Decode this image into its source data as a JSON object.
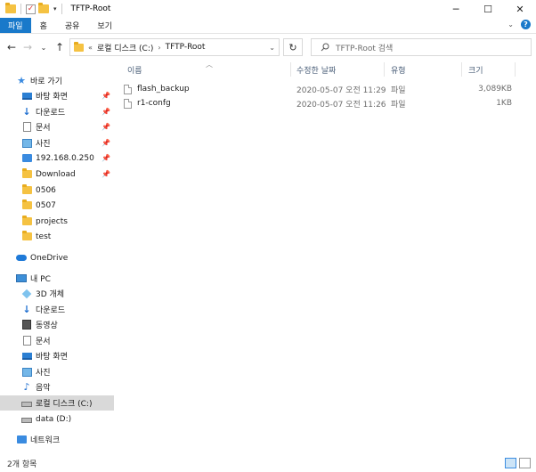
{
  "window": {
    "title": "TFTP-Root",
    "controls": [
      "─",
      "☐",
      "✕"
    ]
  },
  "ribbon": {
    "tabs": [
      "파일",
      "홈",
      "공유",
      "보기"
    ]
  },
  "address": {
    "overflow": "«",
    "crumbs": [
      "로컬 디스크 (C:)",
      "TFTP-Root"
    ],
    "search_placeholder": "TFTP-Root 검색"
  },
  "sidebar": {
    "quick_access": "바로 가기",
    "items": [
      {
        "label": "바탕 화면",
        "icon": "desktop-icon",
        "pinned": true
      },
      {
        "label": "다운로드",
        "icon": "download-icon",
        "pinned": true
      },
      {
        "label": "문서",
        "icon": "document-icon",
        "pinned": true
      },
      {
        "label": "사진",
        "icon": "picture-icon",
        "pinned": true
      },
      {
        "label": "192.168.0.250",
        "icon": "network-drive-icon",
        "pinned": true
      },
      {
        "label": "Download",
        "icon": "folder-icon",
        "pinned": true
      },
      {
        "label": "0506",
        "icon": "folder-icon",
        "pinned": false
      },
      {
        "label": "0507",
        "icon": "folder-icon",
        "pinned": false
      },
      {
        "label": "projects",
        "icon": "folder-icon",
        "pinned": false
      },
      {
        "label": "test",
        "icon": "folder-icon",
        "pinned": false
      }
    ],
    "onedrive": "OneDrive",
    "this_pc": "내 PC",
    "pc_items": [
      {
        "label": "3D 개체",
        "icon": "cube-icon"
      },
      {
        "label": "다운로드",
        "icon": "download-icon"
      },
      {
        "label": "동영상",
        "icon": "video-icon"
      },
      {
        "label": "문서",
        "icon": "document-icon"
      },
      {
        "label": "바탕 화면",
        "icon": "desktop-icon"
      },
      {
        "label": "사진",
        "icon": "picture-icon"
      },
      {
        "label": "음악",
        "icon": "music-icon"
      },
      {
        "label": "로컬 디스크 (C:)",
        "icon": "drive-icon",
        "selected": true
      },
      {
        "label": "data (D:)",
        "icon": "drive-icon"
      }
    ],
    "network": "네트워크"
  },
  "columns": {
    "name": "이름",
    "modified": "수정한 날짜",
    "type": "유형",
    "size": "크기"
  },
  "files": [
    {
      "name": "flash_backup",
      "modified": "2020-05-07 오전 11:29",
      "type": "파일",
      "size": "3,089KB"
    },
    {
      "name": "r1-confg",
      "modified": "2020-05-07 오전 11:26",
      "type": "파일",
      "size": "1KB"
    }
  ],
  "status": {
    "count": "2개 항목"
  }
}
